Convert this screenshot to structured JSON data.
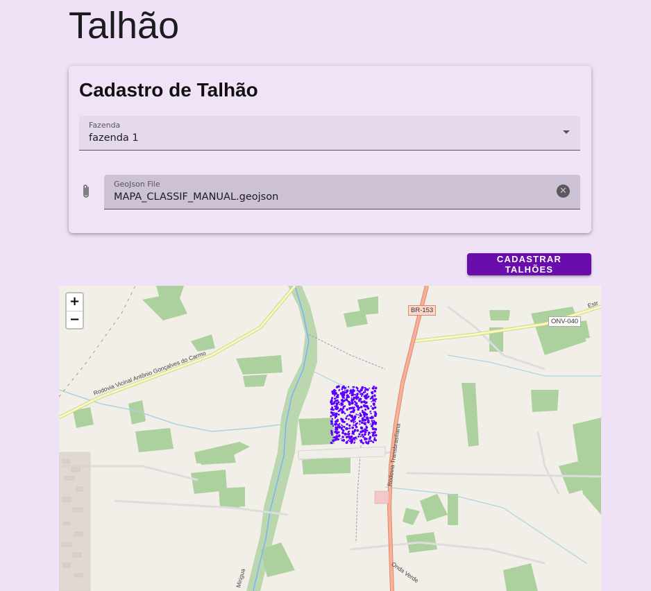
{
  "page": {
    "title": "Talhão"
  },
  "card": {
    "title": "Cadastro de Talhão",
    "fazenda": {
      "label": "Fazenda",
      "value": "fazenda 1"
    },
    "geojson": {
      "label": "GeoJson File",
      "value": "MAPA_CLASSIF_MANUAL.geojson"
    }
  },
  "actions": {
    "submit_label": "CADASTRAR TALHÕES"
  },
  "map": {
    "zoom_in": "+",
    "zoom_out": "−",
    "labels": {
      "br153": "BR-153",
      "onv040": "ONV-040",
      "estr": "Estr",
      "vicinal": "Rodovia Vicinal Antônio Gonçalves do Carmo",
      "transbrasiliana": "Rodovia Transbrasiliana",
      "onda_verde": "Onda Verde",
      "mirigua": "Mirigua"
    },
    "points_color": "#5b00ff"
  },
  "colors": {
    "accent": "#6a0dad",
    "background": "#efe2f7"
  },
  "icons": {
    "attachment": "paperclip-icon",
    "clear": "cancel-icon",
    "dropdown": "arrow-drop-down-icon"
  }
}
